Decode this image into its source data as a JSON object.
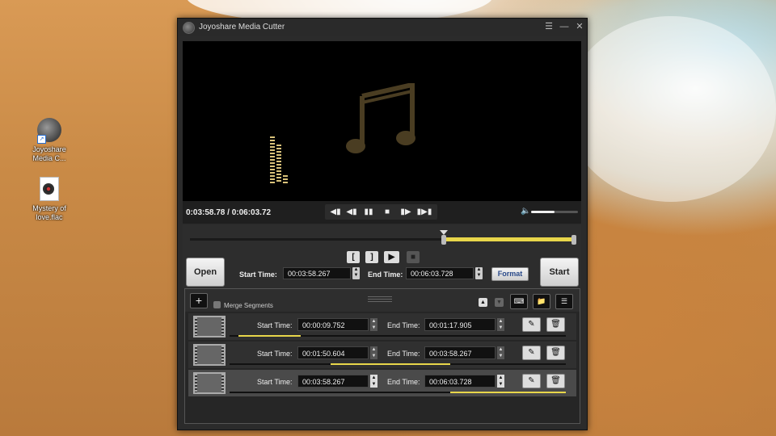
{
  "desktop": {
    "icons": [
      {
        "label_line1": "Joyoshare",
        "label_line2": "Media C...",
        "icon": "app-icon"
      },
      {
        "label_line1": "Mystery of",
        "label_line2": "love.flac",
        "icon": "music-file-icon"
      }
    ]
  },
  "window": {
    "title": "Joyoshare Media Cutter",
    "controls": {
      "menu": "☰",
      "minimize": "—",
      "close": "✕"
    }
  },
  "player": {
    "timecode": "0:03:58.78 / 0:06:03.72",
    "transport": {
      "prev_frame": "◀▮",
      "step_back": "◀▮",
      "pause": "▮▮",
      "stop": "■",
      "step_forward": "▮▶",
      "next_frame": "▮▶▮"
    },
    "volume_level": 0.5
  },
  "cut_panel": {
    "open_label": "Open",
    "start_label": "Start",
    "start_time_label": "Start Time:",
    "start_time": "00:03:58.267",
    "end_time_label": "End Time:",
    "end_time": "00:06:03.728",
    "format_label": "Format",
    "mark_in": "[",
    "mark_out": "]",
    "selection_start_fraction": 0.657,
    "selection_end_fraction": 1.0
  },
  "segments_panel": {
    "add_label": "+",
    "merge_label": "Merge Segments",
    "merge_checked": false,
    "segments": [
      {
        "start_label": "Start Time:",
        "start": "00:00:09.752",
        "end_label": "End Time:",
        "end": "00:01:17.905",
        "selected": false,
        "range": [
          0.027,
          0.212
        ]
      },
      {
        "start_label": "Start Time:",
        "start": "00:01:50.604",
        "end_label": "End Time:",
        "end": "00:03:58.267",
        "selected": false,
        "range": [
          0.301,
          0.657
        ]
      },
      {
        "start_label": "Start Time:",
        "start": "00:03:58.267",
        "end_label": "End Time:",
        "end": "00:06:03.728",
        "selected": true,
        "range": [
          0.657,
          1.0
        ]
      }
    ]
  },
  "colors": {
    "accent": "#e8d64a",
    "window_bg": "#2b2b2b",
    "player_bg": "#000000"
  }
}
